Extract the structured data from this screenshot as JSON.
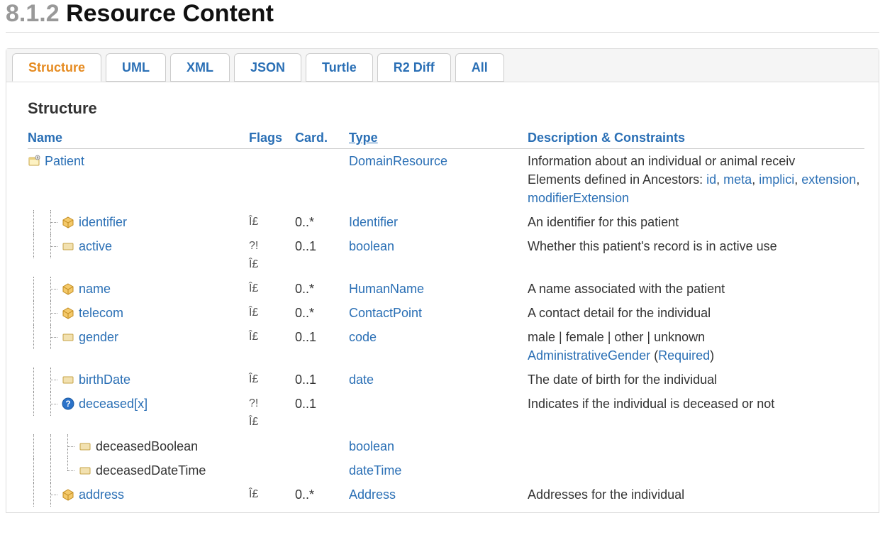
{
  "heading": {
    "number": "8.1.2",
    "title": "Resource Content"
  },
  "tabs": [
    {
      "label": "Structure",
      "active": true
    },
    {
      "label": "UML"
    },
    {
      "label": "XML"
    },
    {
      "label": "JSON"
    },
    {
      "label": "Turtle"
    },
    {
      "label": "R2 Diff"
    },
    {
      "label": "All"
    }
  ],
  "subheading": "Structure",
  "columns": {
    "name": "Name",
    "flags": "Flags",
    "card": "Card.",
    "type": "Type",
    "desc": "Description & Constraints"
  },
  "rows": [
    {
      "depth": 0,
      "icon": "resource",
      "name_kind": "link",
      "name": "Patient",
      "flags": "",
      "card": "",
      "type": "DomainResource",
      "type_kind": "link",
      "desc": {
        "line1": "Information about an individual or animal receiv",
        "ancestorsPrefix": "Elements defined in Ancestors: ",
        "ancestors": [
          "id",
          "meta",
          "implici",
          "extension",
          "modifierExtension"
        ]
      }
    },
    {
      "depth": 1,
      "cont": true,
      "icon": "cube",
      "name_kind": "link",
      "name": "identifier",
      "flags": "Î£",
      "card": "0..*",
      "type": "Identifier",
      "type_kind": "link",
      "desc": {
        "text": "An identifier for this patient"
      }
    },
    {
      "depth": 1,
      "cont": true,
      "icon": "prim",
      "name_kind": "link",
      "name": "active",
      "flags": "?!\nÎ£",
      "card": "0..1",
      "type": "boolean",
      "type_kind": "link",
      "desc": {
        "text": "Whether this patient's record is in active use"
      }
    },
    {
      "depth": 1,
      "cont": true,
      "icon": "cube",
      "name_kind": "link",
      "name": "name",
      "flags": "Î£",
      "card": "0..*",
      "type": "HumanName",
      "type_kind": "link",
      "desc": {
        "text": "A name associated with the patient"
      }
    },
    {
      "depth": 1,
      "cont": true,
      "icon": "cube",
      "name_kind": "link",
      "name": "telecom",
      "flags": "Î£",
      "card": "0..*",
      "type": "ContactPoint",
      "type_kind": "link",
      "desc": {
        "text": "A contact detail for the individual"
      }
    },
    {
      "depth": 1,
      "cont": true,
      "icon": "prim",
      "name_kind": "link",
      "name": "gender",
      "flags": "Î£",
      "card": "0..1",
      "type": "code",
      "type_kind": "link",
      "desc": {
        "text": "male | female | other | unknown",
        "binding_link": "AdministrativeGender",
        "binding_strength": "Required"
      }
    },
    {
      "depth": 1,
      "cont": true,
      "icon": "prim",
      "name_kind": "link",
      "name": "birthDate",
      "flags": "Î£",
      "card": "0..1",
      "type": "date",
      "type_kind": "link",
      "desc": {
        "text": "The date of birth for the individual"
      }
    },
    {
      "depth": 1,
      "cont": true,
      "icon": "choice",
      "name_kind": "link",
      "name": "deceased[x]",
      "flags": "?!\nÎ£",
      "card": "0..1",
      "type": "",
      "type_kind": "none",
      "desc": {
        "text": "Indicates if the individual is deceased or not"
      }
    },
    {
      "depth": 2,
      "cont": true,
      "parent_cont": true,
      "icon": "prim",
      "name_kind": "black",
      "name": "deceasedBoolean",
      "flags": "",
      "card": "",
      "type": "boolean",
      "type_kind": "link",
      "desc": {}
    },
    {
      "depth": 2,
      "cont": false,
      "parent_cont": true,
      "icon": "prim",
      "name_kind": "black",
      "name": "deceasedDateTime",
      "flags": "",
      "card": "",
      "type": "dateTime",
      "type_kind": "link",
      "desc": {}
    },
    {
      "depth": 1,
      "cont": true,
      "icon": "cube",
      "name_kind": "link",
      "name": "address",
      "flags": "Î£",
      "card": "0..*",
      "type": "Address",
      "type_kind": "link",
      "desc": {
        "text": "Addresses for the individual"
      }
    }
  ]
}
